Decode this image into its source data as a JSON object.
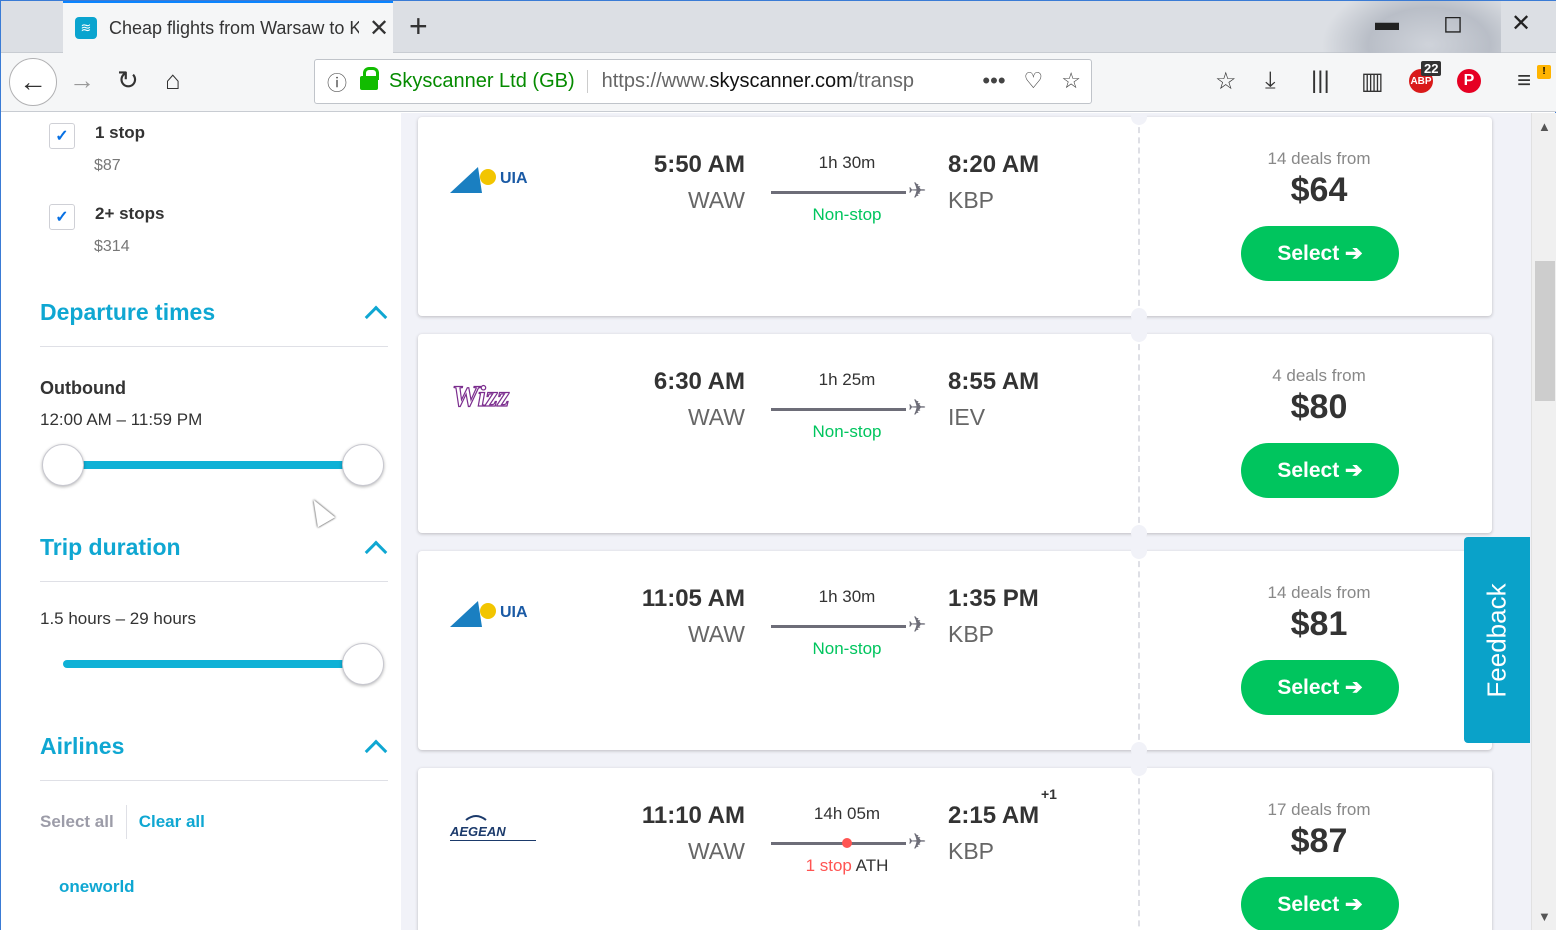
{
  "browser": {
    "tab_title": "Cheap flights from Warsaw to K",
    "url_org": "Skyscanner Ltd (GB)",
    "url_prefix": "https://www.",
    "url_domain": "skyscanner.com",
    "url_suffix": "/transp",
    "abp_badge": "22"
  },
  "filters": {
    "stops": [
      {
        "label": "1 stop",
        "price": "$87",
        "checked": true
      },
      {
        "label": "2+ stops",
        "price": "$314",
        "checked": true
      }
    ],
    "departure_times": {
      "title": "Departure times",
      "outbound_label": "Outbound",
      "range": "12:00 AM – 11:59 PM"
    },
    "trip_duration": {
      "title": "Trip duration",
      "range": "1.5 hours – 29 hours"
    },
    "airlines": {
      "title": "Airlines",
      "select_all": "Select all",
      "clear_all": "Clear all",
      "alliance": "oneworld"
    }
  },
  "flights": [
    {
      "airline": "UIA",
      "dep_time": "5:50 AM",
      "dep_code": "WAW",
      "duration": "1h 30m",
      "stops": "Non-stop",
      "arr_time": "8:20 AM",
      "arr_code": "KBP",
      "deals": "14 deals from",
      "price": "$64",
      "select": "Select ➔"
    },
    {
      "airline": "Wizz",
      "dep_time": "6:30 AM",
      "dep_code": "WAW",
      "duration": "1h 25m",
      "stops": "Non-stop",
      "arr_time": "8:55 AM",
      "arr_code": "IEV",
      "deals": "4 deals from",
      "price": "$80",
      "select": "Select ➔"
    },
    {
      "airline": "UIA",
      "dep_time": "11:05 AM",
      "dep_code": "WAW",
      "duration": "1h 30m",
      "stops": "Non-stop",
      "arr_time": "1:35 PM",
      "arr_code": "KBP",
      "deals": "14 deals from",
      "price": "$81",
      "select": "Select ➔"
    },
    {
      "airline": "AEGEAN",
      "dep_time": "11:10 AM",
      "dep_code": "WAW",
      "duration": "14h 05m",
      "stops_red": "1 stop",
      "stops_city": "ATH",
      "arr_time": "2:15 AM",
      "arr_plus": "+1",
      "arr_code": "KBP",
      "deals": "17 deals from",
      "price": "$87",
      "select": "Select ➔"
    }
  ],
  "feedback": "Feedback",
  "colors": {
    "accent": "#0fa7d2",
    "green": "#00c55e",
    "red": "#ff5452"
  }
}
